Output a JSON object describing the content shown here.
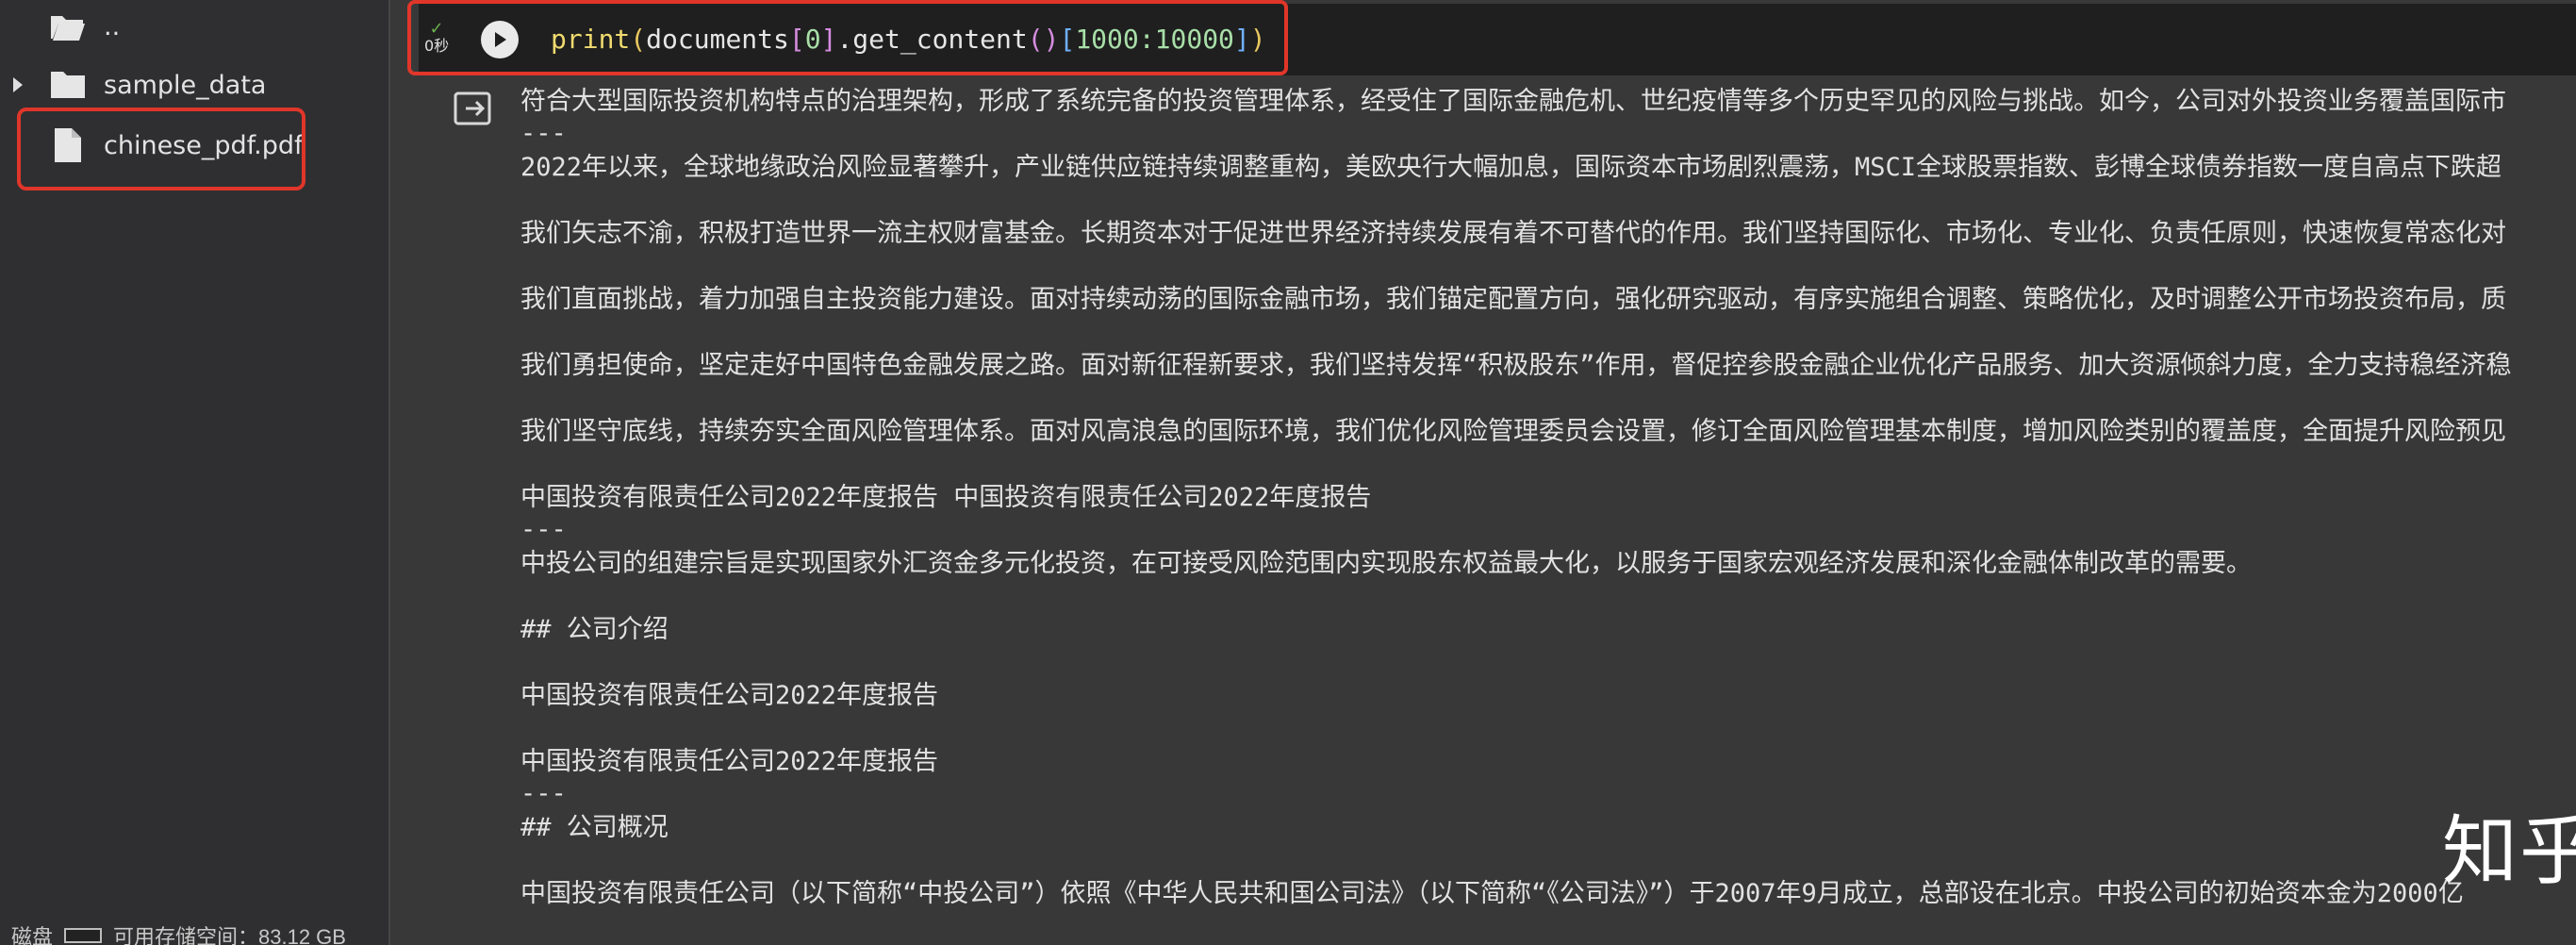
{
  "sidebar": {
    "items": [
      {
        "label": "..",
        "icon": "folder-open-icon"
      },
      {
        "label": "sample_data",
        "icon": "folder-icon"
      },
      {
        "label": "chinese_pdf.pdf",
        "icon": "file-icon"
      }
    ],
    "storage": {
      "label": "磁盘",
      "available": "可用存储空间：83.12 GB"
    }
  },
  "cell": {
    "status_check": "✓",
    "status_time": "0秒",
    "code": {
      "fn": "print",
      "open1": "(",
      "obj": "documents",
      "open2": "[",
      "index": "0",
      "close2": "]",
      "method": ".get_content",
      "call_open": "(",
      "call_close": ")",
      "open3": "[",
      "slice": "1000:10000",
      "close3": "]",
      "close1": ")"
    }
  },
  "output": {
    "lines": [
      "符合大型国际投资机构特点的治理架构，形成了系统完备的投资管理体系，经受住了国际金融危机、世纪疫情等多个历史罕见的风险与挑战。如今，公司对外投资业务覆盖国际市",
      "---",
      "2022年以来，全球地缘政治风险显著攀升，产业链供应链持续调整重构，美欧央行大幅加息，国际资本市场剧烈震荡，MSCI全球股票指数、彭博全球债券指数一度自高点下跌超",
      "我们矢志不渝，积极打造世界一流主权财富基金。长期资本对于促进世界经济持续发展有着不可替代的作用。我们坚持国际化、市场化、专业化、负责任原则，快速恢复常态化对",
      "我们直面挑战，着力加强自主投资能力建设。面对持续动荡的国际金融市场，我们锚定配置方向，强化研究驱动，有序实施组合调整、策略优化，及时调整公开市场投资布局，质",
      "我们勇担使命，坚定走好中国特色金融发展之路。面对新征程新要求，我们坚持发挥“积极股东”作用，督促控参股金融企业优化产品服务、加大资源倾斜力度，全力支持稳经济稳",
      "我们坚守底线，持续夯实全面风险管理体系。面对风高浪急的国际环境，我们优化风险管理委员会设置，修订全面风险管理基本制度，增加风险类别的覆盖度，全面提升风险预见",
      "中国投资有限责任公司2022年度报告 中国投资有限责任公司2022年度报告",
      "---",
      "中投公司的组建宗旨是实现国家外汇资金多元化投资，在可接受风险范围内实现股东权益最大化，以服务于国家宏观经济发展和深化金融体制改革的需要。",
      "## 公司介绍",
      "中国投资有限责任公司2022年度报告",
      "中国投资有限责任公司2022年度报告",
      "---",
      "## 公司概况",
      "中国投资有限责任公司（以下简称“中投公司”）依照《中华人民共和国公司法》（以下简称“《公司法》”）于2007年9月成立，总部设在北京。中投公司的初始资本金为2000亿"
    ]
  },
  "watermark": "知乎 @Kevin",
  "colors": {
    "highlight": "#e0362a",
    "background": "#383838",
    "sidebar": "#2f2f31",
    "cell": "#1f1f1f"
  }
}
